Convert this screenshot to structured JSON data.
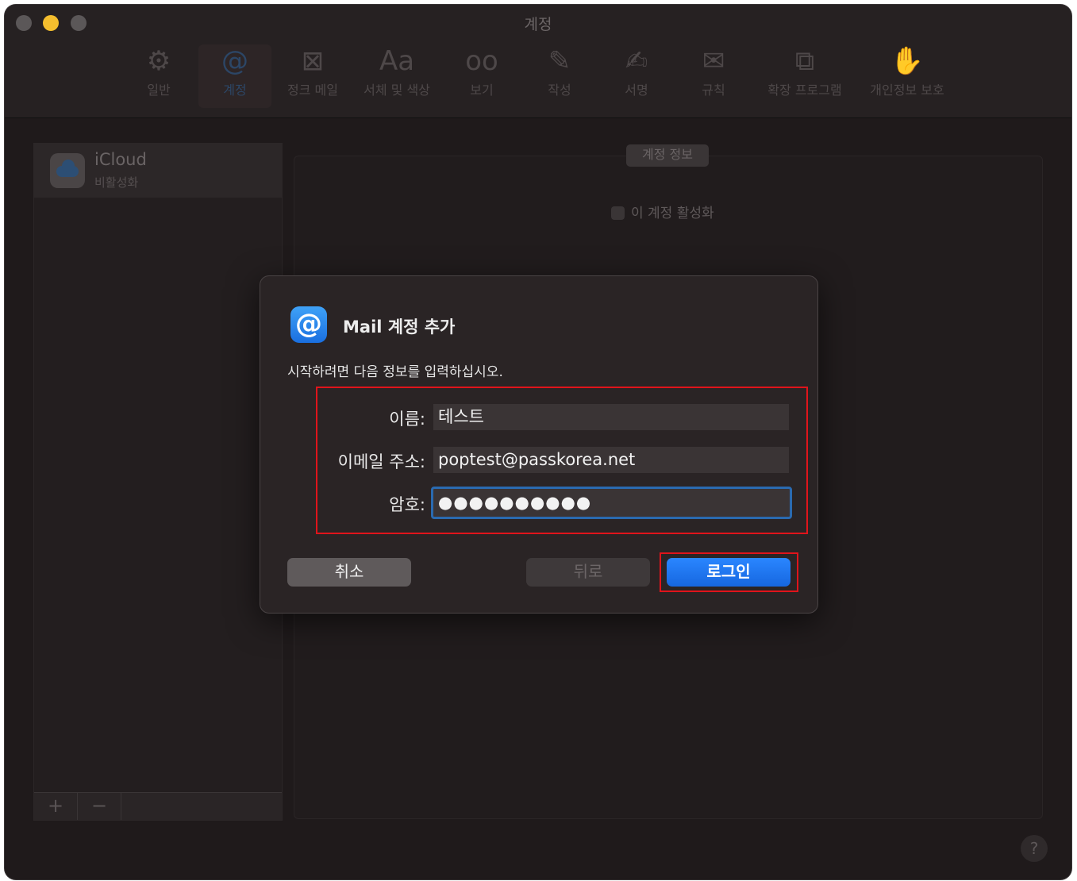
{
  "window": {
    "title": "계정"
  },
  "toolbar": {
    "items": [
      {
        "label": "일반",
        "icon": "gear-icon",
        "glyph": "⚙"
      },
      {
        "label": "계정",
        "icon": "at-icon",
        "glyph": "@"
      },
      {
        "label": "정크 메일",
        "icon": "junk-tray-icon",
        "glyph": "⊠"
      },
      {
        "label": "서체 및 색상",
        "icon": "font-icon",
        "glyph": "Aa"
      },
      {
        "label": "보기",
        "icon": "glasses-icon",
        "glyph": "oo"
      },
      {
        "label": "작성",
        "icon": "compose-icon",
        "glyph": "✎"
      },
      {
        "label": "서명",
        "icon": "signature-icon",
        "glyph": "✍"
      },
      {
        "label": "규칙",
        "icon": "rules-envelope-icon",
        "glyph": "✉"
      },
      {
        "label": "확장 프로그램",
        "icon": "puzzle-icon",
        "glyph": "⧉"
      },
      {
        "label": "개인정보 보호",
        "icon": "hand-icon",
        "glyph": "✋"
      }
    ]
  },
  "sidebar": {
    "accounts": [
      {
        "name": "iCloud",
        "status": "비활성화"
      }
    ],
    "add_label": "+",
    "remove_label": "−"
  },
  "panel": {
    "tab_label": "계정 정보",
    "activate_label": "이 계정 활성화"
  },
  "help_label": "?",
  "dialog": {
    "icon_glyph": "@",
    "title": "Mail 계정 추가",
    "subtitle": "시작하려면 다음 정보를 입력하십시오.",
    "fields": {
      "name_label": "이름:",
      "name_value": "테스트",
      "email_label": "이메일 주소:",
      "email_value": "poptest@passkorea.net",
      "password_label": "암호:",
      "password_value": "●●●●●●●●●●"
    },
    "buttons": {
      "cancel": "취소",
      "back": "뒤로",
      "login": "로그인"
    }
  },
  "colors": {
    "highlight_box": "#e0141b",
    "primary_button": "#1a73f0",
    "focus_ring": "#2a6ab0"
  }
}
